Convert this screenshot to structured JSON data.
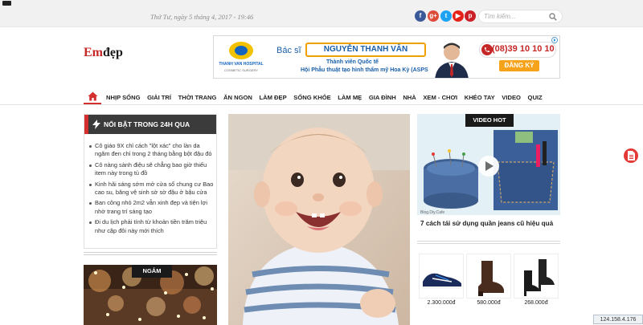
{
  "topbar": {
    "date": "Thứ Tư, ngày 5 tháng 4, 2017 - 19:46",
    "social": [
      {
        "name": "facebook-icon",
        "glyph": "f",
        "color": "#3b5998"
      },
      {
        "name": "google-plus-icon",
        "glyph": "g+",
        "color": "#dd4b39"
      },
      {
        "name": "twitter-icon",
        "glyph": "t",
        "color": "#1da1f2"
      },
      {
        "name": "youtube-icon",
        "glyph": "▶",
        "color": "#e62117"
      },
      {
        "name": "pinterest-icon",
        "glyph": "p",
        "color": "#cb2027"
      }
    ],
    "search_placeholder": "Tìm kiếm..."
  },
  "header": {
    "logo_em": "Em",
    "logo_dep": "đẹp"
  },
  "banner": {
    "hospital_name": "THANH VAN HOSPITAL",
    "hospital_sub": "COSMETIC SURGERY",
    "prefix": "Bác sĩ",
    "doctor_name": "NGUYỄN THANH VÂN",
    "line1": "Thành viên Quốc tế",
    "line2": "Hội Phẫu thuật tạo hình thẩm mỹ Hoa Kỳ (ASPS)",
    "phone": "(08)39 10 10 10",
    "register": "ĐĂNG KÝ"
  },
  "nav": {
    "items": [
      "NHỊP SỐNG",
      "GIẢI TRÍ",
      "THỜI TRANG",
      "ĂN NGON",
      "LÀM ĐẸP",
      "SỐNG KHỎE",
      "LÀM MẸ",
      "GIA ĐÌNH",
      "NHÀ",
      "XEM - CHƠI",
      "KHÉO TAY",
      "VIDEO",
      "QUIZ"
    ],
    "accent": "#d32f2f"
  },
  "hot": {
    "title": "NỔI BẬT TRONG 24H QUA",
    "items": [
      "Cô giáo 9X chỉ cách \"lột xác\" cho làn da ngăm đen chỉ trong 2 tháng bằng bột đậu đỏ",
      "Cô nàng sành điệu sẽ chẳng bao giờ thiếu item này trong tủ đồ",
      "Kinh hãi sáng sớm mở cửa sổ chung cư Bao cao su, băng vệ sinh sờ sờ đậu ở bậu cửa",
      "Ban công nhỏ 2m2 vẫn xinh đẹp và tiện lợi nhờ trang trí sáng tạo",
      "Đi du lịch phải tính từ khoản tiền trăm triệu như cặp đôi này mới thích"
    ]
  },
  "ngam": {
    "label": "NGẮM"
  },
  "video": {
    "label": "VIDEO HOT",
    "title": "7 cách tái sử dụng quần jeans cũ hiệu quả"
  },
  "products": {
    "prices": [
      "2.300.000đ",
      "580.000đ",
      "268.000đ"
    ]
  },
  "ip": "124.158.4.176"
}
